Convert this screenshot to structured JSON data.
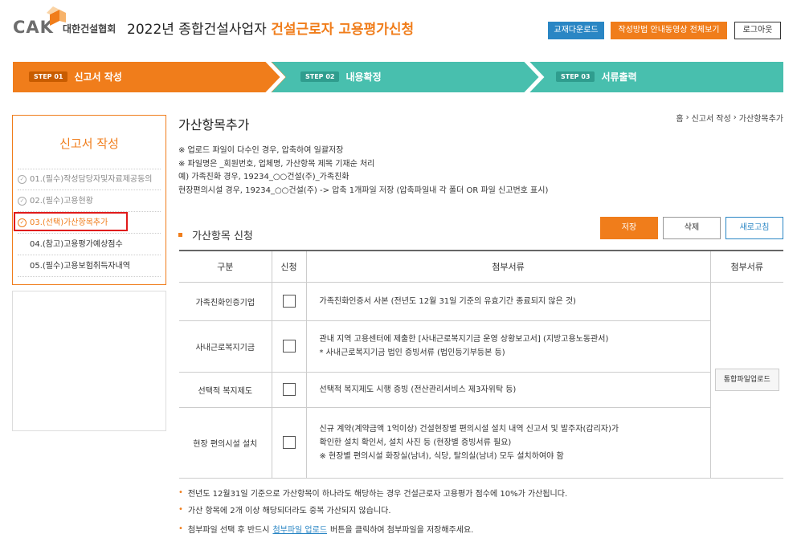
{
  "header": {
    "logo_text": "CAK",
    "logo_org": "대한건설협회",
    "title_prefix": "2022년 종합건설사업자 ",
    "title_highlight": "건설근로자 고용평가신청",
    "btn_download": "교재다운로드",
    "btn_video": "작성방법 안내동영상 전체보기",
    "btn_logout": "로그아웃"
  },
  "steps": [
    {
      "badge": "STEP 01",
      "label": "신고서 작성"
    },
    {
      "badge": "STEP 02",
      "label": "내용확정"
    },
    {
      "badge": "STEP 03",
      "label": "서류출력"
    }
  ],
  "colors": {
    "accent": "#f07d1b",
    "teal": "#48bfae",
    "blue": "#2a86c4",
    "highlight_box": "#e01a1a"
  },
  "sidebar": {
    "title": "신고서 작성",
    "items": [
      {
        "label": "01.(필수)작성담당자및자료제공동의",
        "icon": "check-circle-icon"
      },
      {
        "label": "02.(필수)고용현황",
        "icon": "check-circle-icon"
      },
      {
        "label": "03.(선택)가산항목추가",
        "icon": "check-circle-icon"
      },
      {
        "label": "04.(참고)고용평가예상점수"
      },
      {
        "label": "05.(필수)고용보험취득자내역"
      }
    ]
  },
  "main": {
    "title": "가산항목추가",
    "breadcrumb": [
      "홈",
      "신고서 작성",
      "가산항목추가"
    ],
    "notes": [
      "※ 업로드 파일이 다수인 경우, 압축하여 일괄저장",
      "※ 파일명은 _회원번호, 업체명, 가산항목 제목 기재순 처리",
      "예) 가족친화 경우, 19234_○○건설(주)_가족친화",
      "현장편의시설 경우, 19234_○○건설(주) -> 압축 1개파일 저장 (압축파일내 각 폴더 OR 파일 신고번호 표시)"
    ],
    "section_title": "가산항목 신청",
    "btn_save": "저장",
    "btn_delete": "삭제",
    "btn_refresh": "새로고침",
    "table": {
      "headers": [
        "구분",
        "신청",
        "첨부서류",
        "첨부서류"
      ],
      "rows": [
        {
          "category": "가족친화인증기업",
          "doc1": "가족친화인증서 사본 (전년도 12월 31일 기준의 유효기간 종료되지 않은 것)",
          "doc2": "",
          "doc3": ""
        },
        {
          "category": "사내근로복지기금",
          "doc1": "관내 지역 고용센터에 제출한 [사내근로복지기금 운영 상황보고서] (지방고용노동관서)",
          "doc2": "* 사내근로복지기금 법인 증빙서류 (법인등기부등본 등)",
          "doc3": ""
        },
        {
          "category": "선택적 복지제도",
          "doc1": "선택적 복지제도 시행 증빙 (전산관리서비스 제3자위탁 등)",
          "doc2": "",
          "doc3": ""
        },
        {
          "category": "현장 편의시설 설치",
          "doc1": "신규 계약(계약금액 1억이상) 건설현장별 편의시설 설치 내역 신고서 및 발주자(감리자)가",
          "doc2": "확인한 설치 확인서, 설치 사진 등 (현장별 증빙서류 필요)",
          "doc3": "※ 현장별 편의시설 화장실(남녀), 식당, 탈의실(남녀) 모두 설치하여야 함"
        }
      ],
      "upload_btn": "통합파일업로드"
    },
    "footnotes": [
      "전년도 12월31일 기준으로 가산항목이 하나라도 해당하는 경우 건설근로자 고용평가 점수에 10%가 가산됩니다.",
      "가산 항목에 2개 이상 해당되더라도 중복 가산되지 않습니다."
    ],
    "footnote3_pre": "첨부파일 선택 후 반드시",
    "footnote3_link": "첨부파일 업로드",
    "footnote3_post": "버튼을 클릭하여 첨부파일을 저장해주세요."
  }
}
